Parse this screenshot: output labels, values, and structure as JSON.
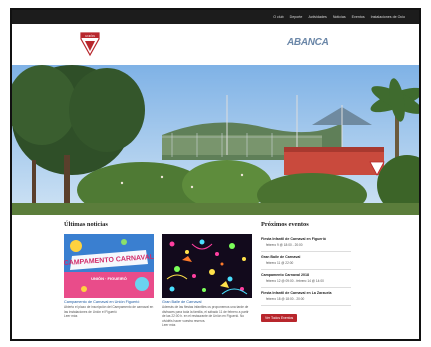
{
  "topnav": {
    "items": [
      "O club",
      "Deporte",
      "Actividades",
      "Noticias",
      "Eventos",
      "Instalaciones de Ocio"
    ]
  },
  "header": {
    "sponsor": "ABANCA",
    "club_badge_text": "UNIÓN"
  },
  "news": {
    "title": "Últimas noticias",
    "cards": [
      {
        "image_caption_1": "CAMPAMENTO CARNAVAL",
        "image_caption_2": "UNIÓN · FIGUEIRÓ",
        "title": "Campamento de Carnaval en Unión Figuerió",
        "text": "Abierto el plazo de inscripción del Campamento de carnaval en las instalaciones de Unión el Figuerió",
        "more": "Leer más"
      },
      {
        "title": "Gran Baile de Carnaval",
        "text": "Además de las fiestas infantiles os proponemos una tarde de disfraces para toda la familia, el sábado 11 de febrero a partir de las 22:00 h. en el restaurante de Unión en Figuerió. No olvidéis hacer vuestra reserva.",
        "more": "Leer más"
      }
    ]
  },
  "events": {
    "title": "Próximos eventos",
    "items": [
      {
        "title": "Fiesta Infantil de Carnaval en Figuerió",
        "date": "febrero 9 @ 18:00 - 20:00"
      },
      {
        "title": "Gran Baile de Carnaval",
        "date": "febrero 11 @ 22:00"
      },
      {
        "title": "Campamento Carnaval 2018",
        "date": "febrero 12 @ 09:00 - febrero 14 @ 14:00"
      },
      {
        "title": "Fiesta Infantil de Carnaval en La Zarzuela",
        "date": "febrero 18 @ 18:00 - 20:00"
      }
    ],
    "button": "Ver Todos Eventos"
  },
  "colors": {
    "brand_red": "#b8262c",
    "link_blue": "#1e5aa0",
    "topbar": "#1c1c1c"
  }
}
